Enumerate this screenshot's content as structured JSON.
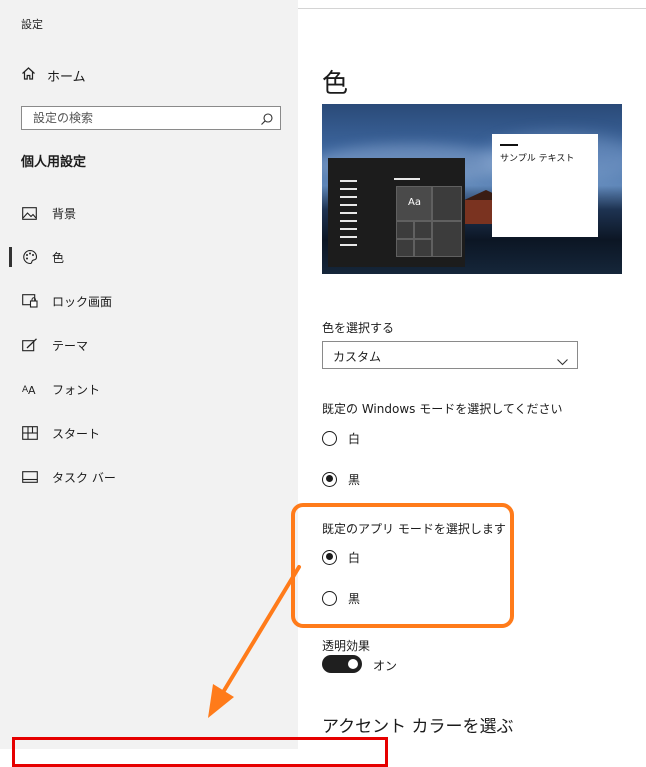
{
  "window": {
    "title": "設定"
  },
  "sidebar": {
    "home_label": "ホーム",
    "search_placeholder": "設定の検索",
    "section_title": "個人用設定",
    "items": [
      {
        "label": "背景",
        "icon": "picture-icon"
      },
      {
        "label": "色",
        "icon": "palette-icon",
        "selected": true
      },
      {
        "label": "ロック画面",
        "icon": "lock-screen-icon"
      },
      {
        "label": "テーマ",
        "icon": "theme-icon"
      },
      {
        "label": "フォント",
        "icon": "font-icon"
      },
      {
        "label": "スタート",
        "icon": "start-icon"
      },
      {
        "label": "タスク バー",
        "icon": "taskbar-icon"
      }
    ]
  },
  "main": {
    "title": "色",
    "preview": {
      "tile_label": "Aa",
      "sample_text": "サンプル テキスト"
    },
    "choose_color": {
      "label": "色を選択する",
      "value": "カスタム"
    },
    "windows_mode": {
      "label": "既定の Windows モードを選択してください",
      "options": [
        {
          "label": "白",
          "checked": false
        },
        {
          "label": "黒",
          "checked": true
        }
      ]
    },
    "app_mode": {
      "label": "既定のアプリ モードを選択します",
      "options": [
        {
          "label": "白",
          "checked": true
        },
        {
          "label": "黒",
          "checked": false
        }
      ]
    },
    "transparency": {
      "label": "透明効果",
      "state_label": "オン",
      "on": true
    },
    "accent_heading": "アクセント カラーを選ぶ"
  },
  "colors": {
    "annotation_orange": "#ff7b1a",
    "annotation_red": "#e60000",
    "sidebar_bg": "#f2f2f2"
  }
}
